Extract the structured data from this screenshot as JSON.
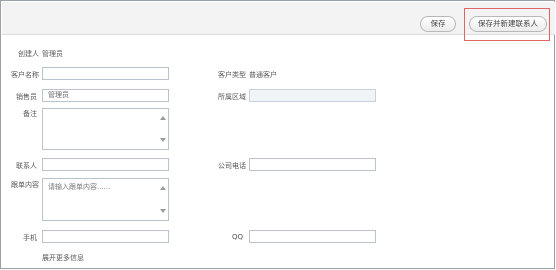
{
  "toolbar": {
    "save_label": "保存",
    "save_new_contact_label": "保存并新建联系人"
  },
  "form": {
    "creator": {
      "label": "创建人",
      "value": "管理员"
    },
    "customer_name": {
      "label": "客户名称",
      "value": ""
    },
    "customer_type": {
      "label": "客户类型",
      "value": "普通客户"
    },
    "salesperson": {
      "label": "销售员",
      "value": "管理员"
    },
    "region": {
      "label": "所属区域",
      "value": ""
    },
    "remarks": {
      "label": "备注",
      "value": ""
    },
    "contact": {
      "label": "联系人",
      "value": ""
    },
    "company_phone": {
      "label": "公司电话",
      "value": ""
    },
    "follow_up": {
      "label": "跟单内容",
      "placeholder": "请输入跟单内容......"
    },
    "mobile": {
      "label": "手机",
      "value": ""
    },
    "qq": {
      "label": "QQ",
      "value": ""
    },
    "expand_more": "展开更多信息"
  }
}
